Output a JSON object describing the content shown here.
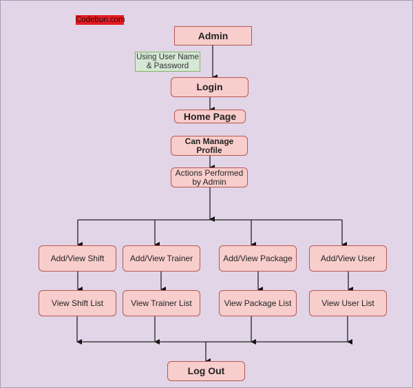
{
  "watermark": "Codebun.com",
  "colors": {
    "background": "#e1d5e7",
    "node_fill": "#f8cecc",
    "node_stroke": "#b85450",
    "note_fill": "#d5e8d4",
    "note_stroke": "#82b366",
    "watermark_bg": "#e51c23"
  },
  "nodes": {
    "admin": "Admin",
    "login_note": "Using User Name & Password",
    "login": "Login",
    "home": "Home Page",
    "profile": "Can Manage Profile",
    "actions": "Actions Performed by Admin",
    "shift": "Add/View Shift",
    "trainer": "Add/View Trainer",
    "package": "Add/View Package",
    "user": "Add/View User",
    "shift_list": "View Shift List",
    "trainer_list": "View Trainer List",
    "package_list": "View Package List",
    "user_list": "View User List",
    "logout": "Log Out"
  }
}
